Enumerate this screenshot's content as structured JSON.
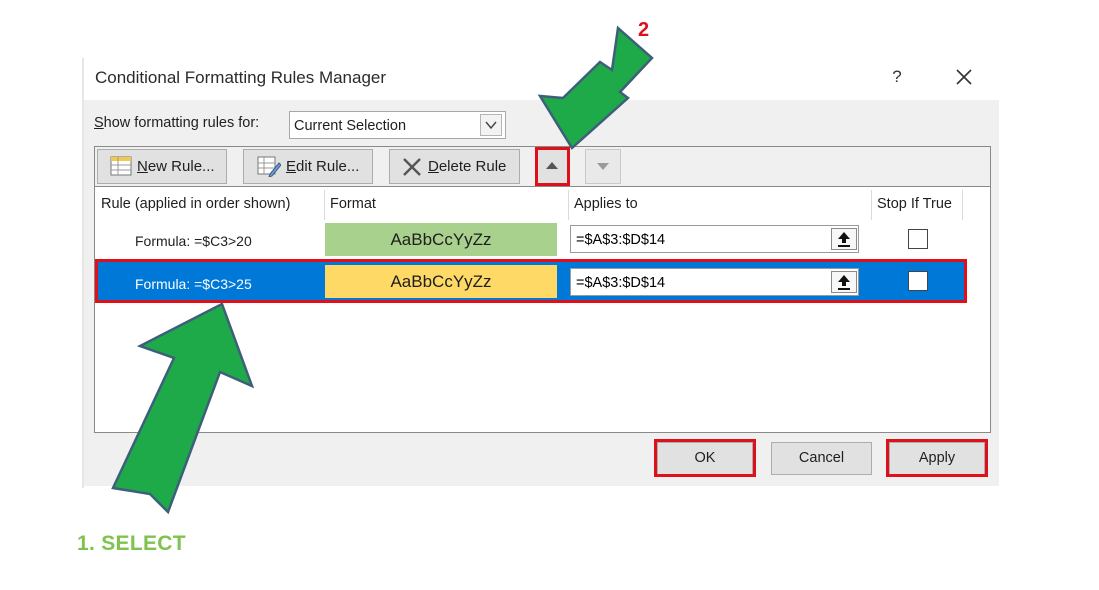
{
  "dialog": {
    "title": "Conditional Formatting Rules Manager",
    "help": "?",
    "show_for_label_prefix": "",
    "show_for_label_mnemonic": "S",
    "show_for_label_rest": "how formatting rules for:",
    "show_for_value": "Current Selection"
  },
  "toolbar": {
    "new_rule": {
      "mnemonic": "N",
      "rest": "ew Rule..."
    },
    "edit_rule": {
      "mnemonic": "E",
      "rest": "dit Rule..."
    },
    "delete_rule": {
      "mnemonic": "D",
      "rest": "elete Rule"
    }
  },
  "columns": [
    "Rule (applied in order shown)",
    "Format",
    "Applies to",
    "Stop If True"
  ],
  "rules": [
    {
      "rule": "Formula: =$C3>20",
      "preview": "AaBbCcYyZz",
      "applies_to": "=$A$3:$D$14",
      "stop_if_true": false,
      "swatch": "#a9d18e",
      "selected": false
    },
    {
      "rule": "Formula: =$C3>25",
      "preview": "AaBbCcYyZz",
      "applies_to": "=$A$3:$D$14",
      "stop_if_true": false,
      "swatch": "#ffd966",
      "selected": true
    }
  ],
  "footer": {
    "ok": "OK",
    "cancel": "Cancel",
    "apply": "Apply"
  },
  "annotations": {
    "step1": "1. SELECT",
    "step2": "2"
  },
  "colors": {
    "selection": "#0078d7",
    "highlight_red": "#e0101a",
    "arrow_green": "#1faa4a",
    "arrow_outline": "#3d5f7a",
    "caption_green": "#7fc24f"
  }
}
